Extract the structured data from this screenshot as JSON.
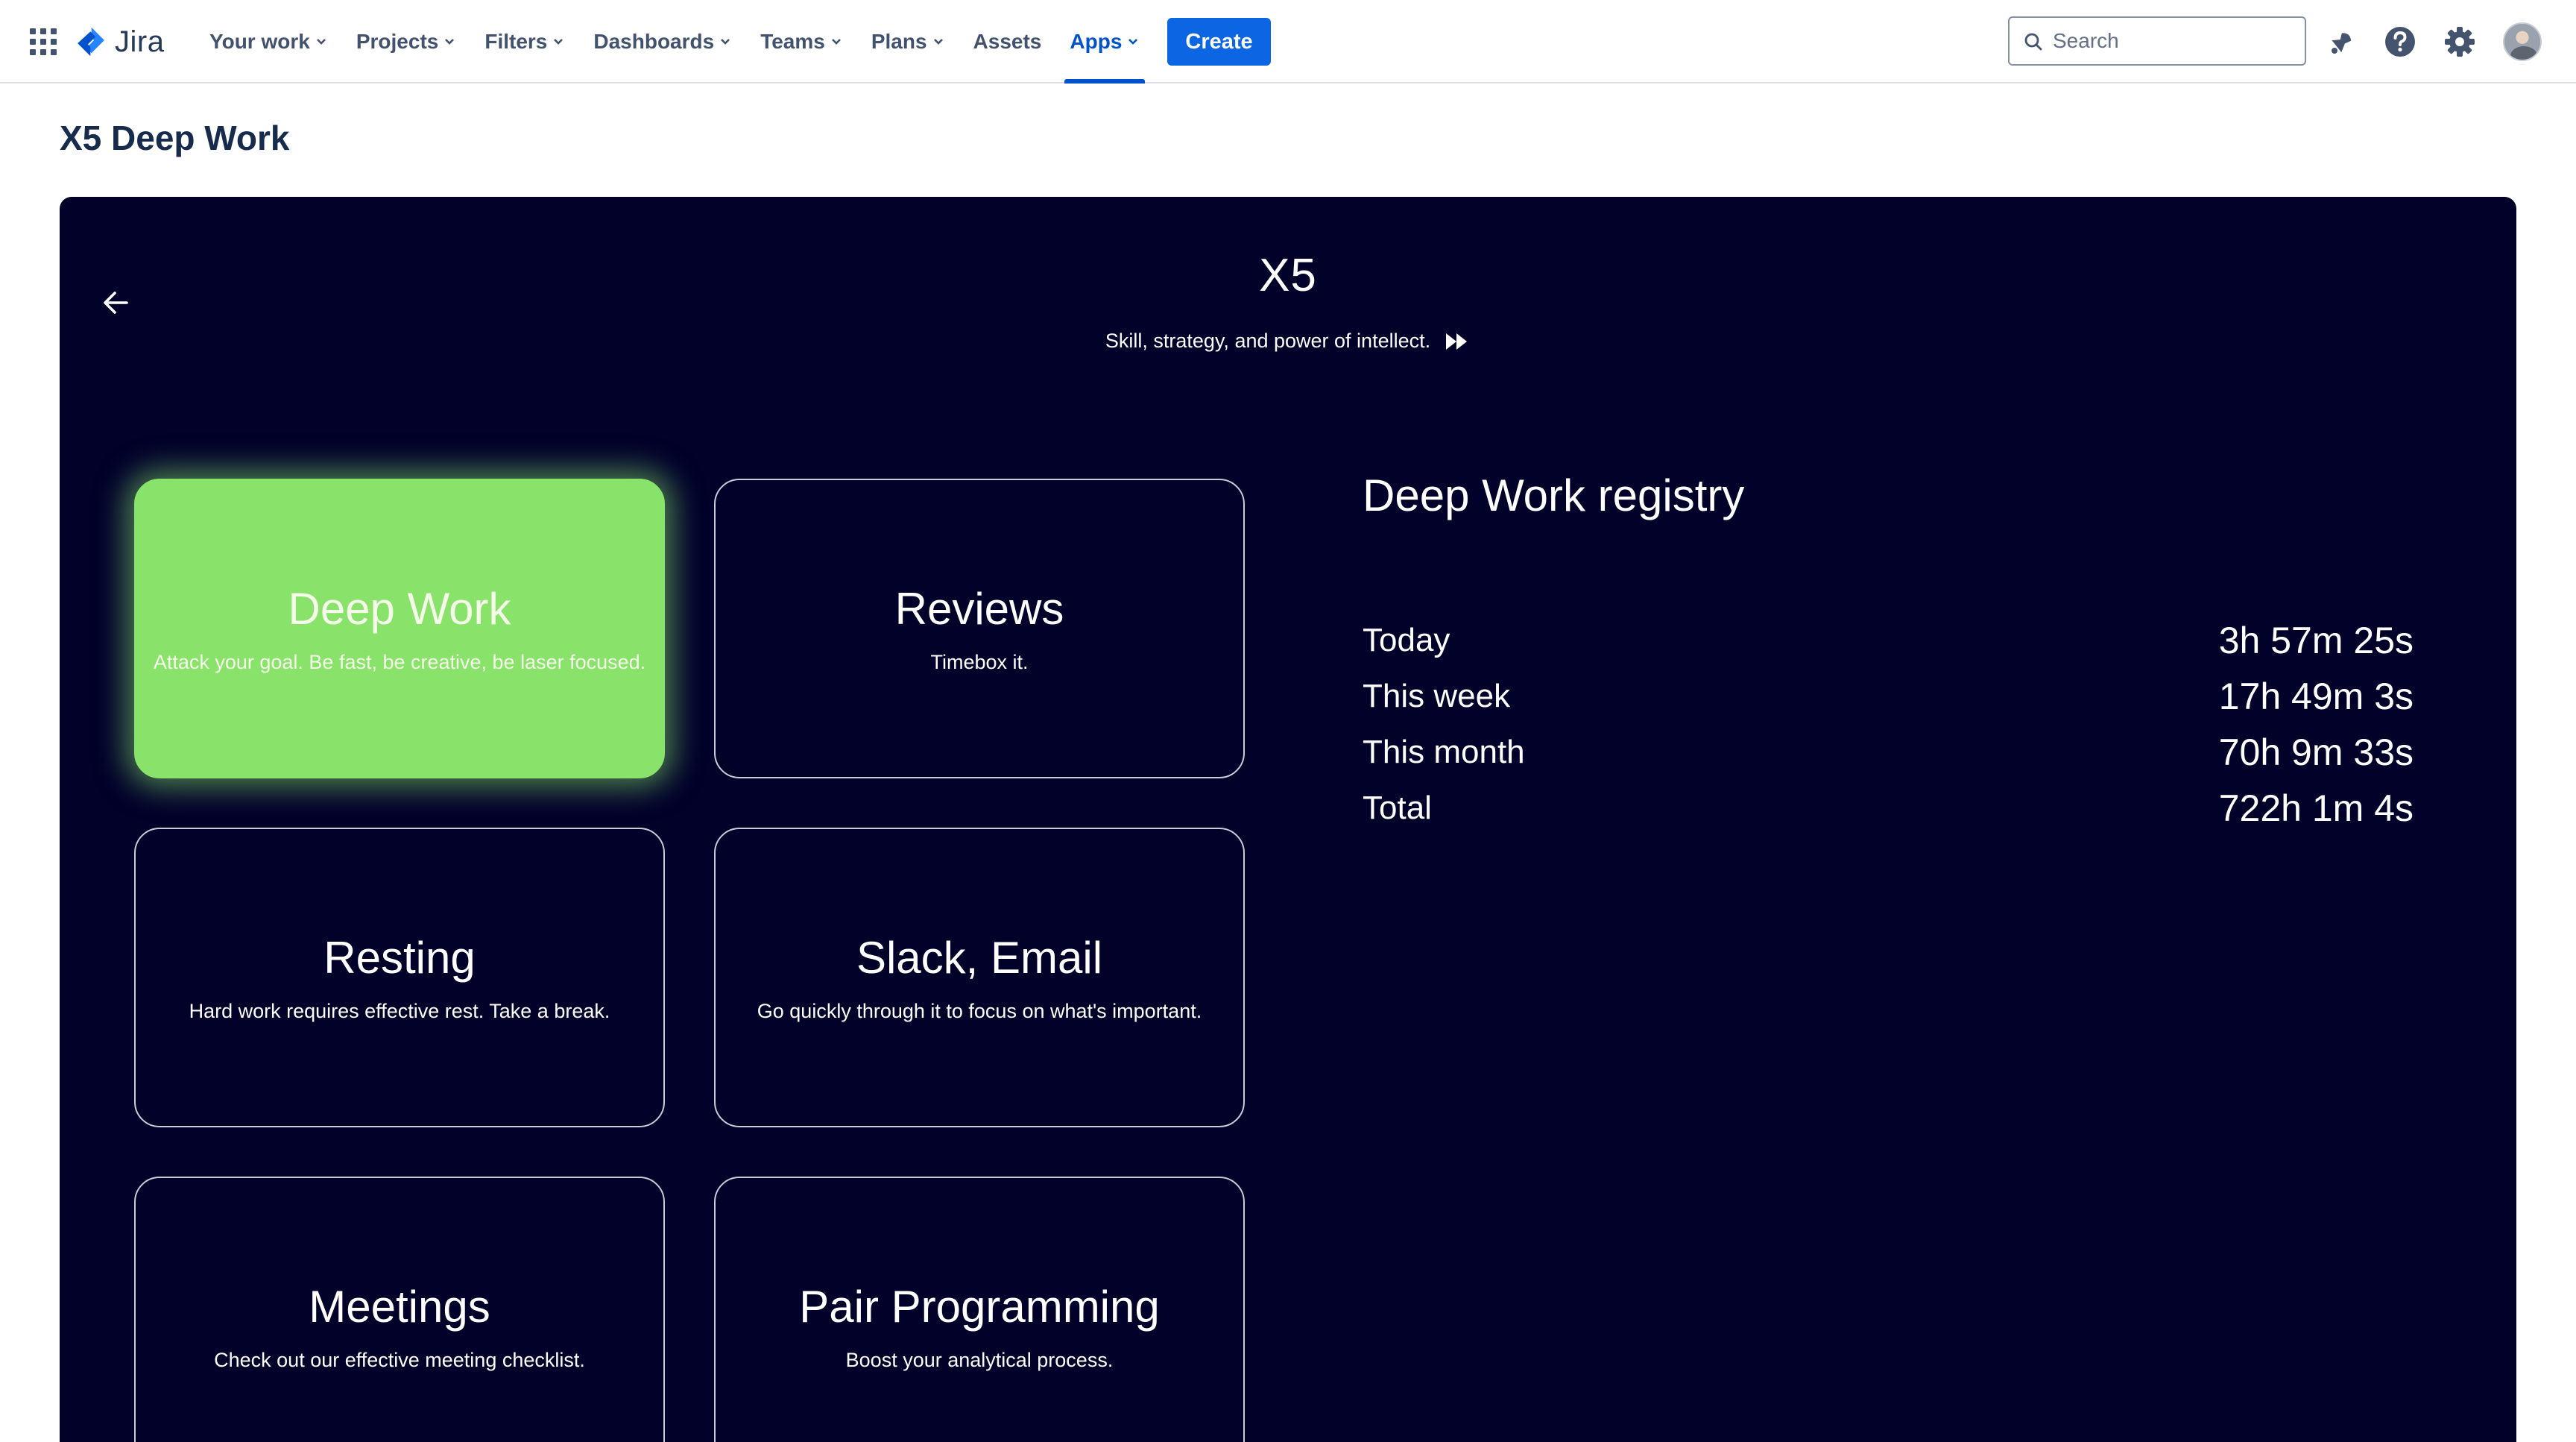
{
  "nav": {
    "logo_text": "Jira",
    "items": [
      {
        "label": "Your work",
        "dropdown": true
      },
      {
        "label": "Projects",
        "dropdown": true
      },
      {
        "label": "Filters",
        "dropdown": true
      },
      {
        "label": "Dashboards",
        "dropdown": true
      },
      {
        "label": "Teams",
        "dropdown": true
      },
      {
        "label": "Plans",
        "dropdown": true
      },
      {
        "label": "Assets",
        "dropdown": false
      },
      {
        "label": "Apps",
        "dropdown": true,
        "active": true
      }
    ],
    "create_label": "Create",
    "search_placeholder": "Search",
    "icons": [
      "notifications-icon",
      "help-icon",
      "settings-icon",
      "avatar"
    ]
  },
  "page": {
    "title": "X5 Deep Work"
  },
  "panel": {
    "brand": "X5",
    "tagline": "Skill, strategy, and power of intellect.",
    "background": "#01012a",
    "accent": "#89e36a",
    "cards": [
      {
        "title": "Deep Work",
        "subtitle": "Attack your goal. Be fast, be creative, be laser focused.",
        "active": true
      },
      {
        "title": "Reviews",
        "subtitle": "Timebox it.",
        "active": false
      },
      {
        "title": "Resting",
        "subtitle": "Hard work requires effective rest. Take a break.",
        "active": false
      },
      {
        "title": "Slack, Email",
        "subtitle": "Go quickly through it to focus on what's important.",
        "active": false
      },
      {
        "title": "Meetings",
        "subtitle": "Check out our effective meeting checklist.",
        "active": false
      },
      {
        "title": "Pair Programming",
        "subtitle": "Boost your analytical process.",
        "active": false
      }
    ],
    "registry": {
      "title": "Deep Work registry",
      "rows": [
        {
          "label": "Today",
          "value": "3h 57m 25s"
        },
        {
          "label": "This week",
          "value": "17h 49m 3s"
        },
        {
          "label": "This month",
          "value": "70h 9m 33s"
        },
        {
          "label": "Total",
          "value": "722h 1m 4s"
        }
      ]
    }
  }
}
